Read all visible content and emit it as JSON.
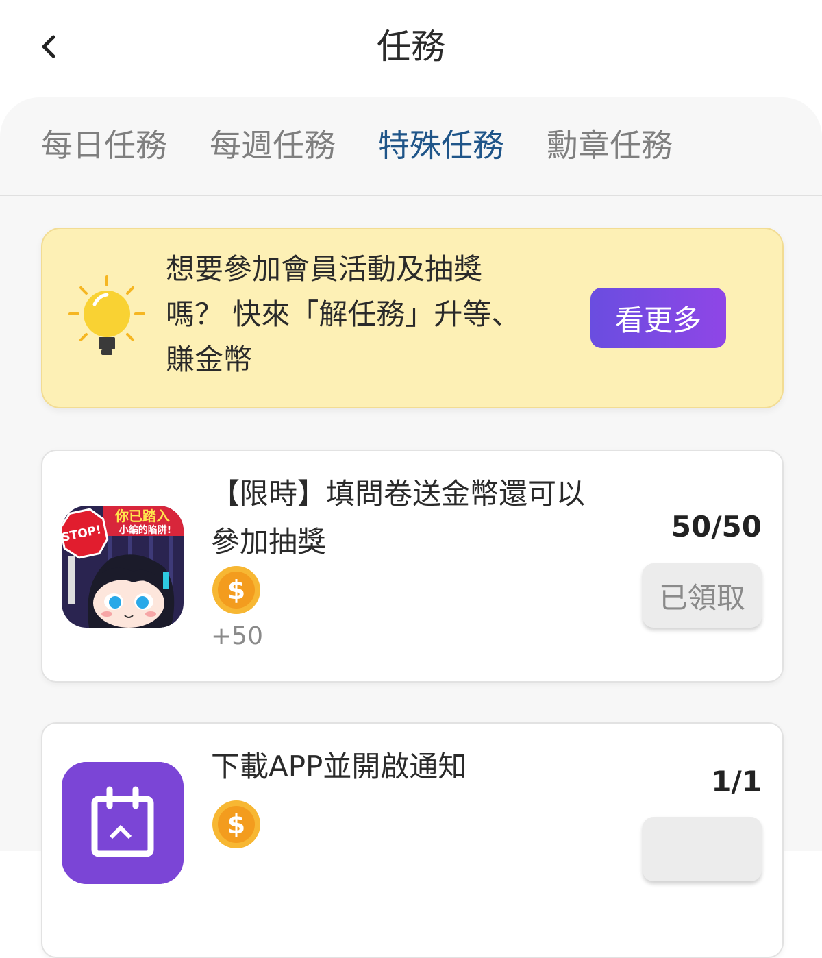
{
  "header": {
    "title": "任務"
  },
  "tabs": [
    {
      "label": "每日任務"
    },
    {
      "label": "每週任務"
    },
    {
      "label": "特殊任務",
      "active": true
    },
    {
      "label": "勳章任務"
    }
  ],
  "tip": {
    "line1": "想要參加會員活動及抽獎",
    "line2": "嗎？ 快來「解任務」升等、",
    "line3": "賺金幣",
    "button": "看更多",
    "icon": "lightbulb-icon"
  },
  "tasks": [
    {
      "title_line1": "【限時】填問卷送金幣還可以",
      "title_line2": "參加抽獎",
      "reward": "+50",
      "progress": "50/50",
      "claim_label": "已領取",
      "thumb_text1": "你已踏入",
      "thumb_text2": "小編的陷阱!",
      "thumb_stop": "STOP!"
    },
    {
      "title_line1": "下載APP並開啟通知",
      "progress": "1/1"
    }
  ],
  "colors": {
    "active_tab": "#1f5589",
    "tab": "#7f7f7f",
    "tip_bg": "#fdf0b5",
    "button_gradient_start": "#6a4de0",
    "button_gradient_end": "#8f46e6",
    "coin": "#f4a623"
  }
}
